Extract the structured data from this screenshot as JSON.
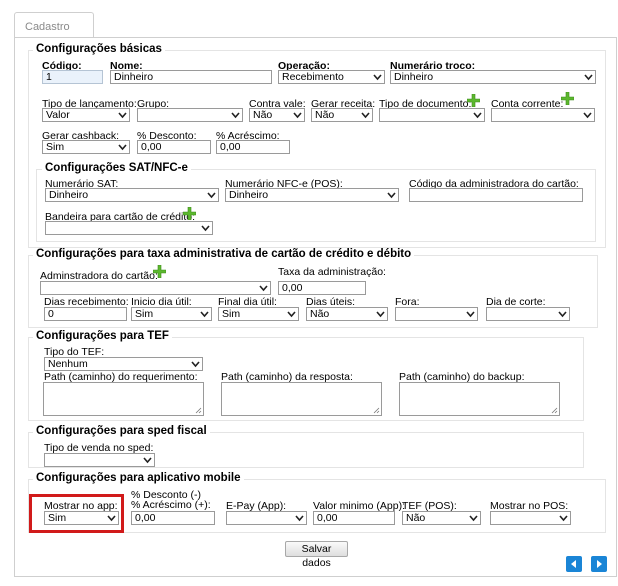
{
  "tab": {
    "label": "Cadastro"
  },
  "basic": {
    "legend": "Configurações básicas",
    "codigo": {
      "label": "Código:",
      "value": "1"
    },
    "nome": {
      "label": "Nome:",
      "value": "Dinheiro"
    },
    "operacao": {
      "label": "Operação:",
      "value": "Recebimento"
    },
    "numerario_troco": {
      "label": "Numerário troco:",
      "value": "Dinheiro"
    },
    "tipo_lancamento": {
      "label": "Tipo de lançamento:",
      "value": "Valor"
    },
    "grupo": {
      "label": "Grupo:",
      "value": ""
    },
    "contra_vale": {
      "label": "Contra vale:",
      "value": "Não"
    },
    "gerar_receita": {
      "label": "Gerar receita:",
      "value": "Não"
    },
    "tipo_documento": {
      "label": "Tipo de documento:",
      "value": ""
    },
    "conta_corrente": {
      "label": "Conta corrente:",
      "value": ""
    },
    "gerar_cashback": {
      "label": "Gerar cashback:",
      "value": "Sim"
    },
    "desconto": {
      "label": "% Desconto:",
      "value": "0,00"
    },
    "acrescimo": {
      "label": "% Acréscimo:",
      "value": "0,00"
    }
  },
  "sat": {
    "legend": "Configurações SAT/NFC-e",
    "numerario_sat": {
      "label": "Numerário SAT:",
      "value": "Dinheiro"
    },
    "numerario_nfce": {
      "label": "Numerário NFC-e (POS):",
      "value": "Dinheiro"
    },
    "codigo_adm": {
      "label": "Código da administradora do cartão:",
      "value": ""
    },
    "bandeira": {
      "label": "Bandeira para cartão de crédito:",
      "value": ""
    }
  },
  "taxa": {
    "legend": "Configurações para taxa administrativa de cartão de crédito e débito",
    "administradora": {
      "label": "Adminstradora do cartão:",
      "value": ""
    },
    "taxa_adm": {
      "label": "Taxa da administração:",
      "value": "0,00"
    },
    "dias_recebimento": {
      "label": "Dias recebimento:",
      "value": "0"
    },
    "inicio_dia_util": {
      "label": "Inicio dia útil:",
      "value": "Sim"
    },
    "final_dia_util": {
      "label": "Final dia útil:",
      "value": "Sim"
    },
    "dias_uteis": {
      "label": "Dias úteis:",
      "value": "Não"
    },
    "fora": {
      "label": "Fora:",
      "value": ""
    },
    "dia_corte": {
      "label": "Dia de corte:",
      "value": ""
    }
  },
  "tef": {
    "legend": "Configurações para TEF",
    "tipo_tef": {
      "label": "Tipo do TEF:",
      "value": "Nenhum"
    },
    "path_req": {
      "label": "Path (caminho) do requerimento:"
    },
    "path_resp": {
      "label": "Path (caminho) da resposta:"
    },
    "path_backup": {
      "label": "Path (caminho) do backup:"
    }
  },
  "sped": {
    "legend": "Configurações para sped fiscal",
    "tipo_venda": {
      "label": "Tipo de venda no sped:",
      "value": ""
    }
  },
  "mobile": {
    "legend": "Configurações para aplicativo mobile",
    "mostrar_app": {
      "label": "Mostrar no app:",
      "value": "Sim"
    },
    "desc_acresc": {
      "label1": "% Desconto (-)",
      "label2": "% Acréscimo (+):",
      "value": "0,00"
    },
    "epay": {
      "label": "E-Pay (App):",
      "value": ""
    },
    "valor_minimo": {
      "label": "Valor minimo (App):",
      "value": "0,00"
    },
    "tef_pos": {
      "label": "TEF (POS):",
      "value": "Não"
    },
    "mostrar_pos": {
      "label": "Mostrar no POS:",
      "value": ""
    }
  },
  "actions": {
    "save_label": "Salvar dados"
  },
  "colors": {
    "highlight": "#d11a1a",
    "nav": "#1a85d6",
    "plus": "#5cb82e"
  },
  "icons": {
    "add": "plus-icon",
    "prev": "arrow-left-icon",
    "next": "arrow-right-icon"
  }
}
